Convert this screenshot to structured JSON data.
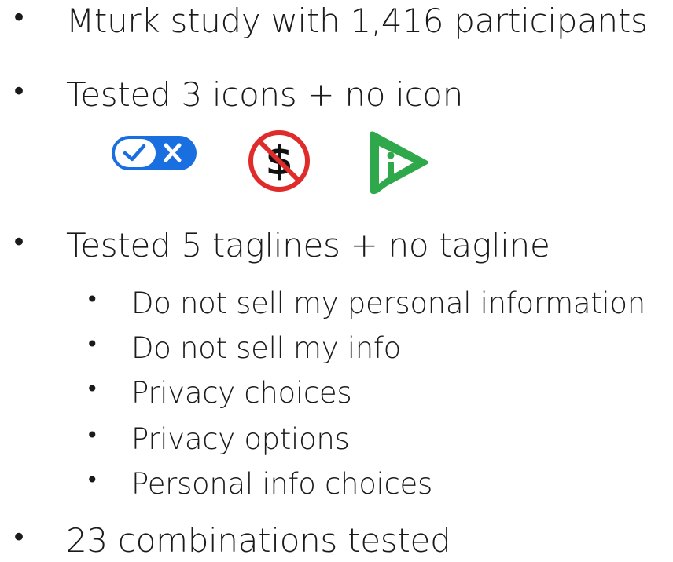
{
  "bullets": {
    "study": "Mturk study with 1,416 participants",
    "icons_tested": "Tested 3 icons + no icon",
    "taglines_tested": "Tested 5 taglines + no tagline",
    "combinations": "23 combinations tested"
  },
  "taglines": [
    "Do not sell my personal information",
    "Do not sell my info",
    "Privacy choices",
    "Privacy options",
    "Personal info choices"
  ],
  "icons": [
    {
      "name": "toggle-check-x-icon",
      "color": "#1a6fe0"
    },
    {
      "name": "no-dollar-icon",
      "color": "#e02b2b"
    },
    {
      "name": "green-play-info-icon",
      "color": "#2ea84a"
    }
  ],
  "bullet_glyph": "•"
}
